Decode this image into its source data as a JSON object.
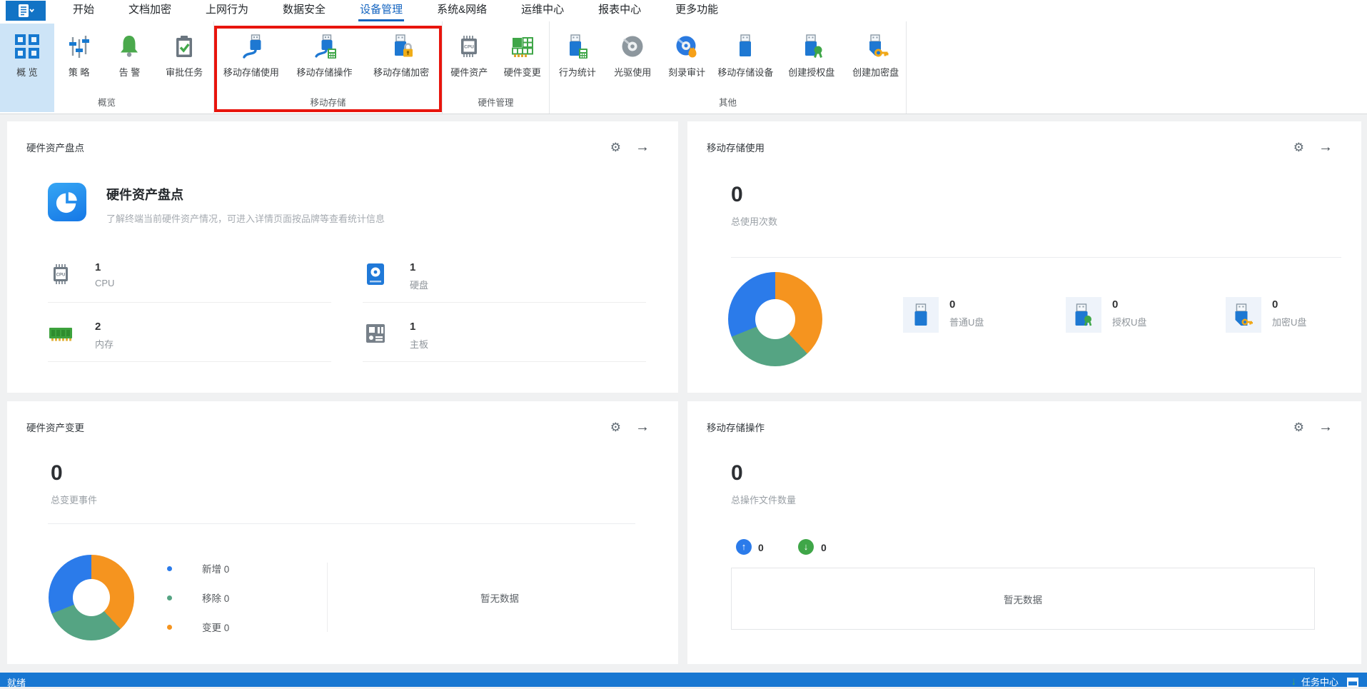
{
  "menu": {
    "items": [
      "开始",
      "文档加密",
      "上网行为",
      "数据安全",
      "设备管理",
      "系统&网络",
      "运维中心",
      "报表中心",
      "更多功能"
    ],
    "active": "设备管理"
  },
  "ribbon": {
    "groups": [
      {
        "label": "概览",
        "buttons": [
          "概 览",
          "策 略",
          "告 警",
          "审批任务"
        ]
      },
      {
        "label": "移动存储",
        "buttons": [
          "移动存储使用",
          "移动存储操作",
          "移动存储加密"
        ]
      },
      {
        "label": "硬件管理",
        "buttons": [
          "硬件资产",
          "硬件变更"
        ]
      },
      {
        "label": "其他",
        "buttons": [
          "行为统计",
          "光驱使用",
          "刻录审计",
          "移动存储设备",
          "创建授权盘",
          "创建加密盘"
        ]
      }
    ],
    "highlight_color": "#e8150d"
  },
  "cards": {
    "hw_inventory": {
      "header": "硬件资产盘点",
      "title": "硬件资产盘点",
      "subtitle": "了解终端当前硬件资产情况，可进入详情页面按品牌等查看统计信息",
      "stats": [
        {
          "value": "1",
          "label": "CPU",
          "icon": "cpu-icon"
        },
        {
          "value": "1",
          "label": "硬盘",
          "icon": "harddisk-icon"
        },
        {
          "value": "2",
          "label": "内存",
          "icon": "memory-icon"
        },
        {
          "value": "1",
          "label": "主板",
          "icon": "mainboard-icon"
        }
      ]
    },
    "storage_usage": {
      "header": "移动存储使用",
      "total_value": "0",
      "total_label": "总使用次数",
      "stats": [
        {
          "value": "0",
          "label": "普通U盘",
          "icon": "usb-plain-icon"
        },
        {
          "value": "0",
          "label": "授权U盘",
          "icon": "usb-authorized-icon"
        },
        {
          "value": "0",
          "label": "加密U盘",
          "icon": "usb-encrypted-icon"
        }
      ]
    },
    "hw_changes": {
      "header": "硬件资产变更",
      "total_value": "0",
      "total_label": "总变更事件",
      "legend": [
        {
          "label": "新增",
          "value": "0",
          "color": "#2b7bea"
        },
        {
          "label": "移除",
          "value": "0",
          "color": "#55a483"
        },
        {
          "label": "变更",
          "value": "0",
          "color": "#f5941f"
        }
      ],
      "empty_text": "暂无数据"
    },
    "storage_ops": {
      "header": "移动存储操作",
      "total_value": "0",
      "total_label": "总操作文件数量",
      "upload_value": "0",
      "download_value": "0",
      "empty_text": "暂无数据"
    }
  },
  "donut": {
    "segments": [
      {
        "color": "#f5941f",
        "from": 0,
        "to": 137
      },
      {
        "color": "#55a483",
        "from": 137,
        "to": 248
      },
      {
        "color": "#2b7bea",
        "from": 248,
        "to": 360
      }
    ]
  },
  "status_bar": {
    "ready": "就绪",
    "task_center": "任务中心"
  }
}
